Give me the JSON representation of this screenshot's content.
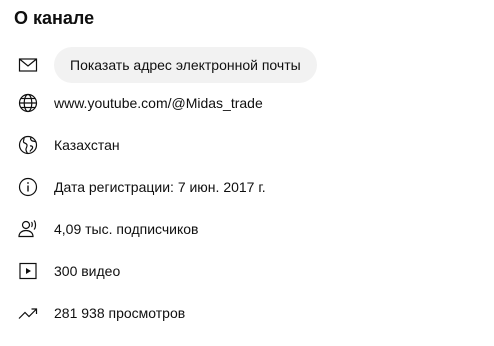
{
  "section": {
    "title": "О канале"
  },
  "details": {
    "email_button_label": "Показать адрес электронной почты",
    "website": "www.youtube.com/@Midas_trade",
    "country": "Казахстан",
    "joined": "Дата регистрации: 7 июн. 2017 г.",
    "subscribers": "4,09 тыс. подписчиков",
    "videos": "300 видео",
    "views": "281 938 просмотров"
  },
  "icons": {
    "email": "mail-icon",
    "website": "globe-icon",
    "country": "earth-icon",
    "joined": "info-icon",
    "subscribers": "person-icon",
    "videos": "play-box-icon",
    "views": "trending-icon"
  }
}
